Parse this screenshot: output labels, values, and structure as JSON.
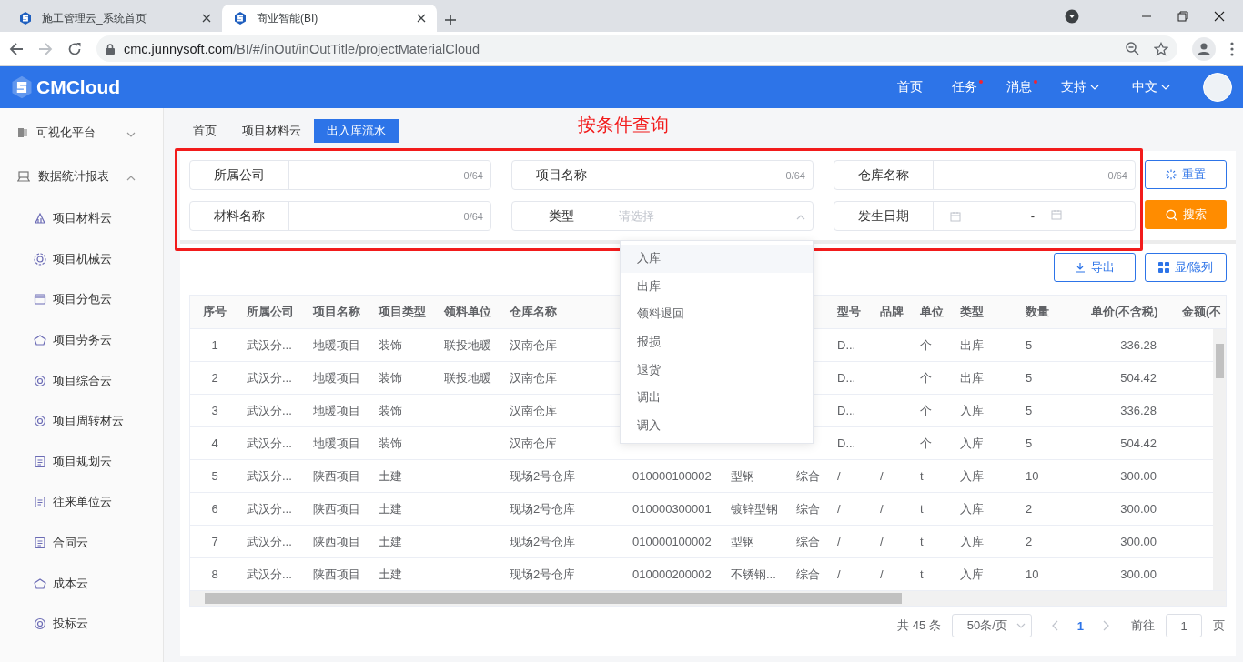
{
  "browser": {
    "tabs": [
      {
        "title": "施工管理云_系统首页",
        "selected": false
      },
      {
        "title": "商业智能(BI)",
        "selected": true
      }
    ],
    "url_host": "cmc.junnysoft.com",
    "url_path": "/BI/#/inOut/inOutTitle/projectMaterialCloud"
  },
  "header": {
    "logo": "CMCloud",
    "nav": [
      {
        "label": "首页",
        "kind": "link",
        "dot": false
      },
      {
        "label": "任务",
        "kind": "link",
        "dot": true
      },
      {
        "label": "消息",
        "kind": "link",
        "dot": true
      },
      {
        "label": "支持",
        "kind": "menu",
        "dot": false
      },
      {
        "label": "中文",
        "kind": "menu",
        "dot": false
      }
    ]
  },
  "sidebar": {
    "items": [
      {
        "label": "可视化平台",
        "expanded": false
      },
      {
        "label": "数据统计报表",
        "expanded": true,
        "children": [
          {
            "label": "项目材料云"
          },
          {
            "label": "项目机械云"
          },
          {
            "label": "项目分包云"
          },
          {
            "label": "项目劳务云"
          },
          {
            "label": "项目综合云"
          },
          {
            "label": "项目周转材云"
          },
          {
            "label": "项目规划云"
          },
          {
            "label": "往来单位云"
          },
          {
            "label": "合同云"
          },
          {
            "label": "成本云"
          },
          {
            "label": "投标云"
          }
        ]
      }
    ]
  },
  "breadcrumb": [
    {
      "label": "首页",
      "selected": false
    },
    {
      "label": "项目材料云",
      "selected": false
    },
    {
      "label": "出入库流水",
      "selected": true
    }
  ],
  "annotation": {
    "label": "按条件查询"
  },
  "search": {
    "fields": [
      {
        "kind": "text",
        "label": "所属公司",
        "counter": "0/64"
      },
      {
        "kind": "text",
        "label": "项目名称",
        "counter": "0/64"
      },
      {
        "kind": "text",
        "label": "仓库名称",
        "counter": "0/64"
      },
      {
        "kind": "text",
        "label": "材料名称",
        "counter": "0/64"
      },
      {
        "kind": "select",
        "label": "类型",
        "placeholder": "请选择",
        "expanded": true,
        "options": [
          {
            "label": "入库",
            "highlighted": true
          },
          {
            "label": "出库",
            "highlighted": false
          },
          {
            "label": "领料退回",
            "highlighted": false
          },
          {
            "label": "报损",
            "highlighted": false
          },
          {
            "label": "退货",
            "highlighted": false
          },
          {
            "label": "调出",
            "highlighted": false
          },
          {
            "label": "调入",
            "highlighted": false
          }
        ]
      },
      {
        "kind": "daterange",
        "label": "发生日期",
        "separator": "-"
      }
    ],
    "buttons": [
      {
        "label": "重置",
        "kind": "reset"
      },
      {
        "label": "搜索",
        "kind": "search"
      }
    ]
  },
  "toolbar": [
    {
      "label": "导出",
      "kind": "export"
    },
    {
      "label": "显/隐列",
      "kind": "columns"
    }
  ],
  "table": {
    "columns": [
      {
        "label": "序号"
      },
      {
        "label": "所属公司"
      },
      {
        "label": "项目名称"
      },
      {
        "label": "项目类型"
      },
      {
        "label": "领料单位"
      },
      {
        "label": "仓库名称"
      },
      {},
      {},
      {},
      {
        "label": "型号"
      },
      {
        "label": "品牌"
      },
      {
        "label": "单位"
      },
      {
        "label": "类型"
      },
      {
        "label": "数量"
      },
      {
        "label": "单价(不含税)"
      },
      {
        "label": "金额(不"
      }
    ],
    "rows": [
      [
        "1",
        "武汉分...",
        "地暖项目",
        "装饰",
        "联投地暖",
        "汉南仓库",
        null,
        null,
        null,
        "D...",
        null,
        "个",
        "出库",
        "5",
        "336.28",
        null
      ],
      [
        "2",
        "武汉分...",
        "地暖项目",
        "装饰",
        "联投地暖",
        "汉南仓库",
        null,
        null,
        null,
        "D...",
        null,
        "个",
        "出库",
        "5",
        "504.42",
        null
      ],
      [
        "3",
        "武汉分...",
        "地暖项目",
        "装饰",
        null,
        "汉南仓库",
        null,
        null,
        null,
        "D...",
        null,
        "个",
        "入库",
        "5",
        "336.28",
        null
      ],
      [
        "4",
        "武汉分...",
        "地暖项目",
        "装饰",
        null,
        "汉南仓库",
        null,
        null,
        null,
        "D...",
        null,
        "个",
        "入库",
        "5",
        "504.42",
        null
      ],
      [
        "5",
        "武汉分...",
        "陕西项目",
        "土建",
        null,
        "现场2号仓库",
        "010000100002",
        "型钢",
        "综合",
        "/",
        "/",
        "t",
        "入库",
        "10",
        "300.00",
        null
      ],
      [
        "6",
        "武汉分...",
        "陕西项目",
        "土建",
        null,
        "现场2号仓库",
        "010000300001",
        "镀锌型钢",
        "综合",
        "/",
        "/",
        "t",
        "入库",
        "2",
        "300.00",
        null
      ],
      [
        "7",
        "武汉分...",
        "陕西项目",
        "土建",
        null,
        "现场2号仓库",
        "010000100002",
        "型钢",
        "综合",
        "/",
        "/",
        "t",
        "入库",
        "2",
        "300.00",
        null
      ],
      [
        "8",
        "武汉分...",
        "陕西项目",
        "土建",
        null,
        "现场2号仓库",
        "010000200002",
        "不锈钢...",
        "综合",
        "/",
        "/",
        "t",
        "入库",
        "10",
        "300.00",
        null
      ]
    ]
  },
  "pagination": {
    "total": "共 45 条",
    "page_size": "50条/页",
    "pages": [
      {
        "label": "1",
        "selected": true
      }
    ],
    "goto_label": "前往",
    "goto_value": "1",
    "goto_suffix": "页"
  }
}
